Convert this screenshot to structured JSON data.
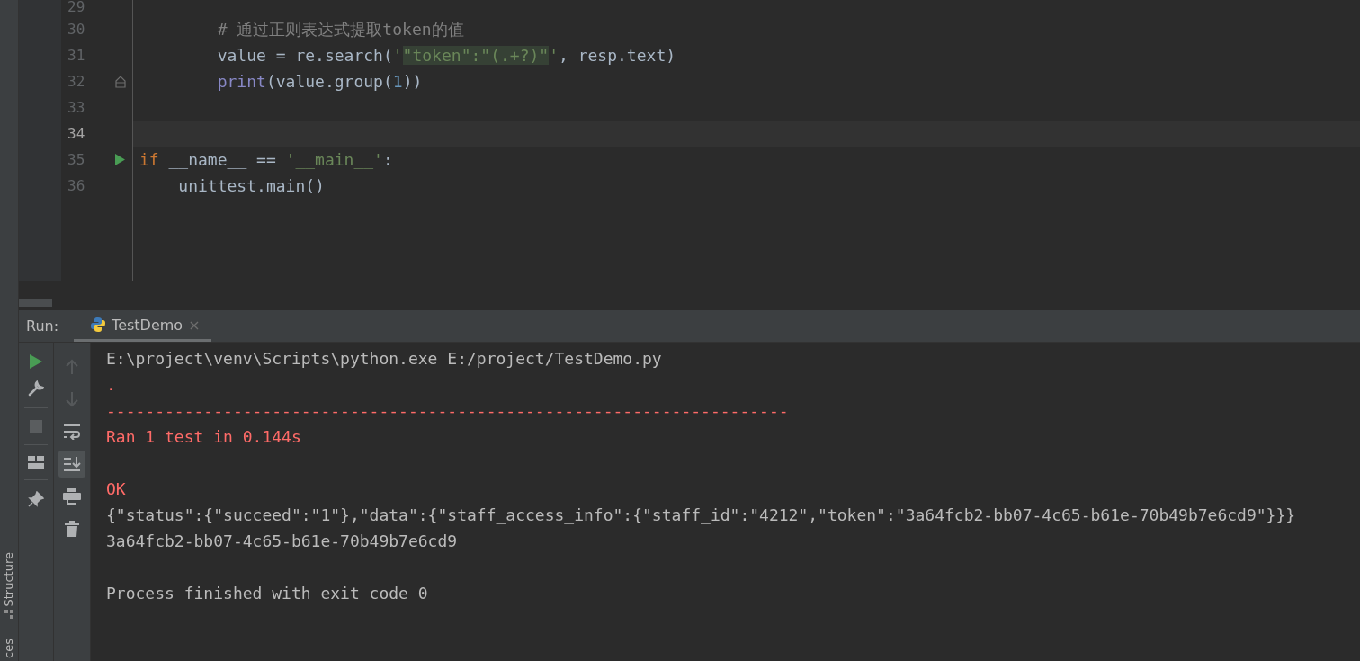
{
  "side_strip": {
    "labels": [
      "Structure",
      "ces"
    ]
  },
  "editor": {
    "lines": [
      {
        "number": "29",
        "current": false,
        "kind": "code"
      },
      {
        "number": "30",
        "current": false,
        "kind": "code",
        "tokens": [
          {
            "kind": "comment",
            "text": "        # 通过正则表达式提取token的值"
          }
        ]
      },
      {
        "number": "31",
        "current": false,
        "kind": "code",
        "tokens": [
          {
            "kind": "plain",
            "text": "        value = re.search("
          },
          {
            "kind": "string",
            "text": "'"
          },
          {
            "kind": "regex",
            "text": "\"token\":\"(.+?)\""
          },
          {
            "kind": "string",
            "text": "'"
          },
          {
            "kind": "plain",
            "text": ", resp.text)"
          }
        ]
      },
      {
        "number": "32",
        "current": false,
        "kind": "fold",
        "tokens": [
          {
            "kind": "builtin",
            "text": "        print"
          },
          {
            "kind": "plain",
            "text": "(value.group("
          },
          {
            "kind": "number",
            "text": "1"
          },
          {
            "kind": "plain",
            "text": "))"
          }
        ]
      },
      {
        "number": "33",
        "current": false,
        "kind": "code"
      },
      {
        "number": "34",
        "current": true,
        "kind": "code"
      },
      {
        "number": "35",
        "current": false,
        "kind": "run",
        "tokens": [
          {
            "kind": "keyword",
            "text": "if"
          },
          {
            "kind": "plain",
            "text": " __name__ == "
          },
          {
            "kind": "string",
            "text": "'__main__'"
          },
          {
            "kind": "plain",
            "text": ":"
          }
        ]
      },
      {
        "number": "36",
        "current": false,
        "kind": "code",
        "tokens": [
          {
            "kind": "plain",
            "text": "    unittest.main()"
          }
        ]
      }
    ]
  },
  "run_panel": {
    "label": "Run:",
    "tabs": [
      {
        "title": "TestDemo",
        "close": "×",
        "selected": true
      }
    ],
    "tools": [
      {
        "kind": "run"
      },
      {
        "kind": "wrench"
      },
      {
        "kind": "divider"
      },
      {
        "kind": "stop"
      },
      {
        "kind": "divider"
      },
      {
        "kind": "layout"
      },
      {
        "kind": "divider"
      },
      {
        "kind": "pin"
      }
    ],
    "console_tools": [
      {
        "kind": "up",
        "disabled": true,
        "selected": false
      },
      {
        "kind": "down",
        "disabled": true,
        "selected": false
      },
      {
        "kind": "wrap",
        "disabled": false,
        "selected": false
      },
      {
        "kind": "scroll-end",
        "disabled": false,
        "selected": true
      },
      {
        "kind": "print",
        "disabled": false,
        "selected": false
      },
      {
        "kind": "trash",
        "disabled": false,
        "selected": false
      }
    ],
    "console": [
      [
        {
          "kind": "command",
          "text": "E:\\project\\venv\\Scripts\\python.exe E:/project/TestDemo.py"
        },
        {
          "kind": "error",
          "text": "."
        },
        {
          "kind": "error",
          "text": "----------------------------------------------------------------------"
        },
        {
          "kind": "error",
          "text": "Ran 1 test in 0.144s"
        }
      ],
      [
        {
          "kind": "error",
          "text": "OK"
        },
        {
          "kind": "output",
          "text": "{\"status\":{\"succeed\":\"1\"},\"data\":{\"staff_access_info\":{\"staff_id\":\"4212\",\"token\":\"3a64fcb2-bb07-4c65-b61e-70b49b7e6cd9\"}}}"
        },
        {
          "kind": "output",
          "text": "3a64fcb2-bb07-4c65-b61e-70b49b7e6cd9"
        }
      ],
      [
        {
          "kind": "output",
          "text": "Process finished with exit code 0"
        }
      ]
    ]
  }
}
